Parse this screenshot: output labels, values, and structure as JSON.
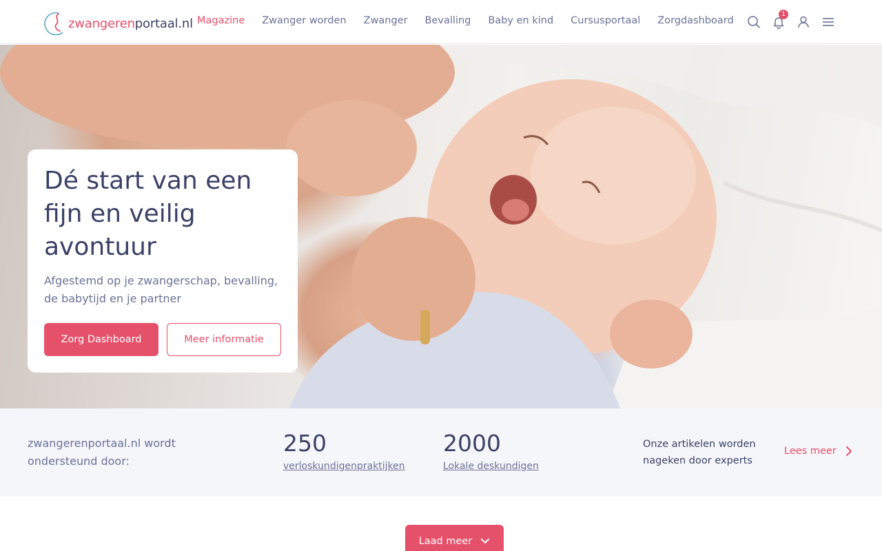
{
  "header": {
    "logo": {
      "part1": "zwangeren",
      "part2": "portaal.nl"
    },
    "nav": [
      {
        "label": "Magazine",
        "active": true
      },
      {
        "label": "Zwanger worden"
      },
      {
        "label": "Zwanger"
      },
      {
        "label": "Bevalling"
      },
      {
        "label": "Baby en kind"
      },
      {
        "label": "Cursusportaal"
      },
      {
        "label": "Zorgdashboard"
      }
    ],
    "icons": [
      "search-icon",
      "bell-icon",
      "user-icon",
      "menu-icon"
    ],
    "notification_count": "1"
  },
  "hero": {
    "title": "Dé start van een fijn en veilig avontuur",
    "subtitle": "Afgestemd op je zwangerschap, bevalling, de babytijd en je partner",
    "primary_button": "Zorg Dashboard",
    "secondary_button": "Meer informatie"
  },
  "stats": {
    "supported_text": "zwangerenportaal.nl wordt ondersteund door:",
    "items": [
      {
        "number": "250",
        "label": "verloskundigenpraktijken"
      },
      {
        "number": "2000",
        "label": "Lokale deskundigen"
      }
    ],
    "experts_text": "Onze artikelen worden nageken door experts",
    "read_more": "Lees meer"
  },
  "load_more": "Laad meer",
  "colors": {
    "accent": "#e5506a",
    "text_dark": "#3b4166",
    "text_muted": "#6b7197",
    "stats_bg": "#f5f6fa"
  }
}
